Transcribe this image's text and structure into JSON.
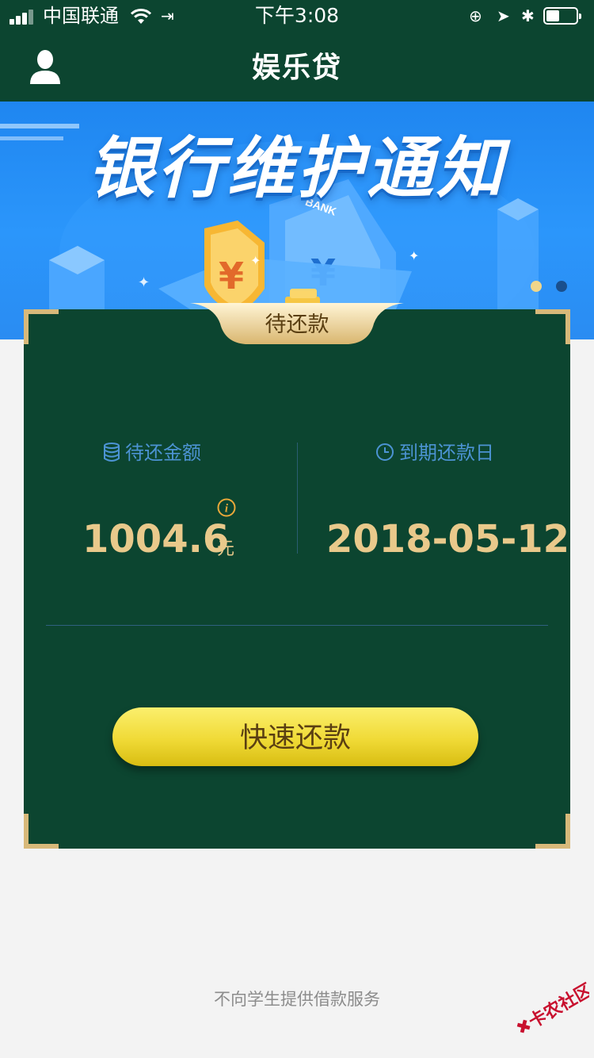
{
  "status_bar": {
    "carrier": "中国联通",
    "time": "下午3:08",
    "battery_level": 0.45
  },
  "header": {
    "title": "娱乐贷",
    "avatar_icon": "user-icon"
  },
  "banner": {
    "title": "银行维护通知",
    "image_text": "BANK",
    "carousel_total": 2,
    "carousel_active": 2,
    "colors": {
      "background": "#2b96fb",
      "dot_active": "#1a4f8c",
      "dot_inactive": "#f0d68a"
    }
  },
  "card": {
    "tag": "待还款",
    "amount_label": "待还金额",
    "amount_icon": "coins-icon",
    "amount_value": "1004.6",
    "amount_unit": "元",
    "info_icon": "info-icon",
    "due_label": "到期还款日",
    "due_icon": "clock-icon",
    "due_date": "2018-05-12",
    "pay_button": "快速还款",
    "colors": {
      "background": "#0c4530",
      "accent": "#d8b97a",
      "value": "#e9c98b",
      "label": "#4c93d3",
      "button": "#f0da36"
    }
  },
  "footer": {
    "note": "不向学生提供借款服务"
  },
  "watermark": "卡农社区"
}
